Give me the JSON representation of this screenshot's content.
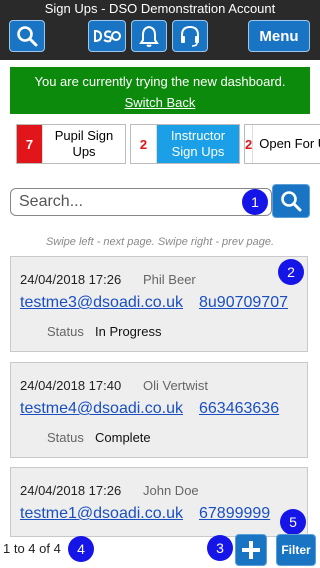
{
  "header": {
    "title": "Sign Ups - DSO Demonstration Account",
    "menu_label": "Menu",
    "icons": [
      "search-icon",
      "dso-logo-icon",
      "bell-icon",
      "headset-icon"
    ]
  },
  "banner": {
    "message": "You are currently trying the new dashboard.",
    "switch_back": "Switch Back"
  },
  "tabs": [
    {
      "count": "7",
      "label": "Pupil Sign Ups",
      "active": false
    },
    {
      "count": "2",
      "label": "Instructor Sign Ups",
      "active": true
    },
    {
      "count": "2",
      "label": "Open For Ups",
      "active": false
    }
  ],
  "search": {
    "placeholder": "Search...",
    "value": ""
  },
  "hint": "Swipe left - next page. Swipe right - prev page.",
  "status_label": "Status",
  "signups": [
    {
      "datetime": "24/04/2018 17:26",
      "name": "Phil Beer",
      "email": "testme3@dsoadi.co.uk",
      "phone": "8u90709707",
      "status": "In Progress"
    },
    {
      "datetime": "24/04/2018 17:40",
      "name": "Oli Vertwist",
      "email": "testme4@dsoadi.co.uk",
      "phone": "663463636",
      "status": "Complete"
    },
    {
      "datetime": "24/04/2018 17:26",
      "name": "John Doe",
      "email": "testme1@dsoadi.co.uk",
      "phone": "67899999",
      "status": ""
    }
  ],
  "footer": {
    "paging": "1 to 4 of 4",
    "filter_label": "Filter"
  },
  "badges": [
    "1",
    "2",
    "3",
    "4",
    "5"
  ],
  "colors": {
    "primary": "#1a74c4",
    "banner": "#0c8a0c",
    "active_tab": "#1ba0e8",
    "count_red": "#e0161a",
    "badge": "#1515e8",
    "link": "#1a4fc2"
  }
}
